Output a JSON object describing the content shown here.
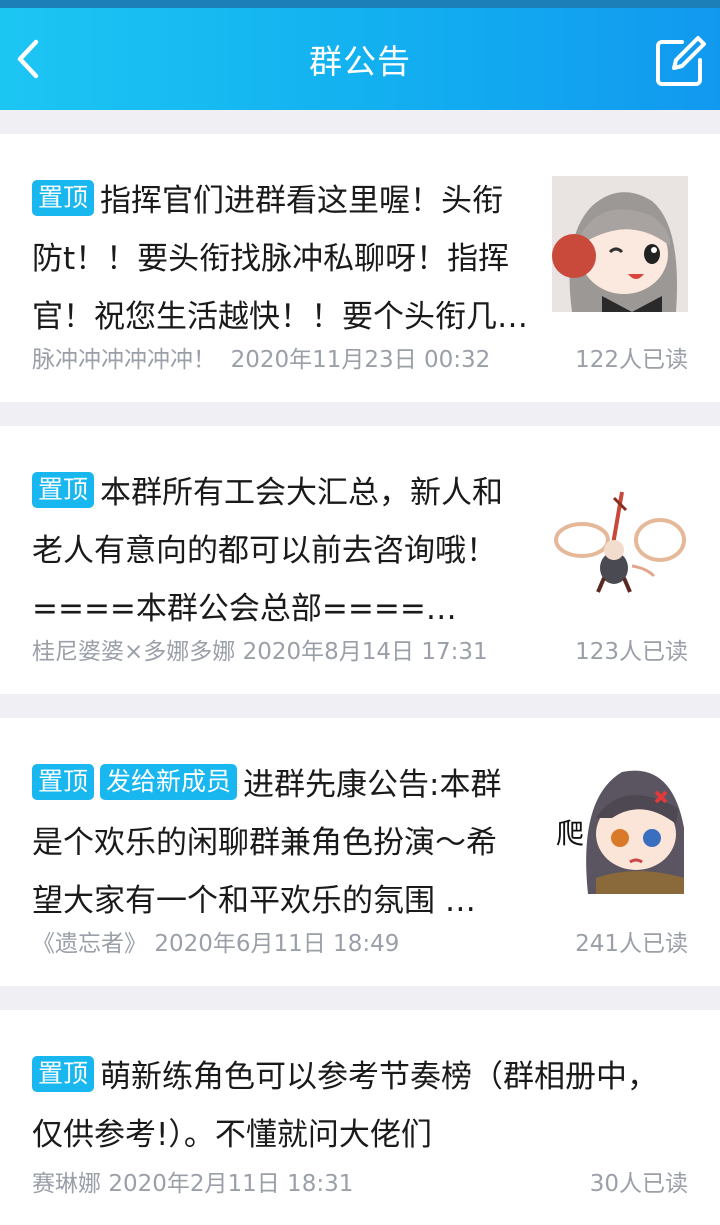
{
  "header": {
    "title": "群公告"
  },
  "announcements": [
    {
      "tags": [
        "置顶"
      ],
      "lines": [
        "指挥官们进群看这里喔！头衔",
        "防t！！要头衔找脉冲私聊呀！指挥",
        "官！祝您生活越快！！要个头衔几…"
      ],
      "author": "脉冲冲冲冲冲冲！",
      "time": "2020年11月23日 00:32",
      "reads": "122人已读",
      "thumbnail": "anime-girl-wink"
    },
    {
      "tags": [
        "置顶"
      ],
      "lines": [
        "本群所有工会大汇总，新人和",
        "老人有意向的都可以前去咨询哦！",
        "====本群公会总部====…"
      ],
      "author": "桂尼婆婆×多娜多娜",
      "time": "2020年8月14日 17:31",
      "reads": "123人已读",
      "thumbnail": "chibi-swordsman"
    },
    {
      "tags": [
        "置顶",
        "发给新成员"
      ],
      "lines": [
        "进群先康公告:本群",
        "是个欢乐的闲聊群兼角色扮演～希",
        "望大家有一个和平欢乐的氛围 …"
      ],
      "author": "《遗忘者》",
      "time": "2020年6月11日 18:49",
      "reads": "241人已读",
      "thumbnail": "chibi-crawl",
      "thumbnail_text": "爬"
    },
    {
      "tags": [
        "置顶"
      ],
      "lines": [
        "萌新练角色可以参考节奏榜（群相册中，",
        "仅供参考!）。不懂就问大佬们"
      ],
      "author": "赛琳娜",
      "time": "2020年2月11日 18:31",
      "reads": "30人已读"
    }
  ]
}
